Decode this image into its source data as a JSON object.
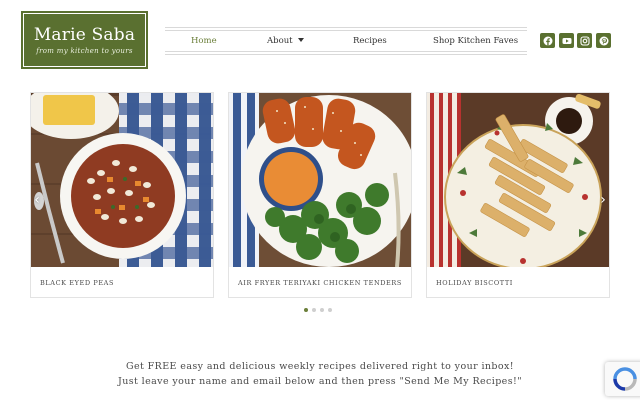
{
  "logo": {
    "title": "Marie Saba",
    "tagline": "from my kitchen to yours"
  },
  "nav": {
    "items": [
      {
        "label": "Home",
        "active": true
      },
      {
        "label": "About",
        "has_dropdown": true
      },
      {
        "label": "Recipes"
      },
      {
        "label": "Shop Kitchen Faves"
      }
    ]
  },
  "social": [
    "facebook-icon",
    "youtube-icon",
    "instagram-icon",
    "pinterest-icon"
  ],
  "carousel": {
    "slides": [
      {
        "caption": "BLACK EYED PEAS"
      },
      {
        "caption": "AIR FRYER TERIYAKI CHICKEN TENDERS"
      },
      {
        "caption": "HOLIDAY BISCOTTI"
      }
    ],
    "dots": 4,
    "active_dot": 0
  },
  "promo": {
    "line1": "Get FREE easy and delicious weekly recipes delivered right to your inbox!",
    "line2": "Just leave your name and email below and then press \"Send Me My Recipes!\""
  },
  "colors": {
    "brand_green": "#5a7030",
    "accent_green": "#6b7f3a"
  }
}
